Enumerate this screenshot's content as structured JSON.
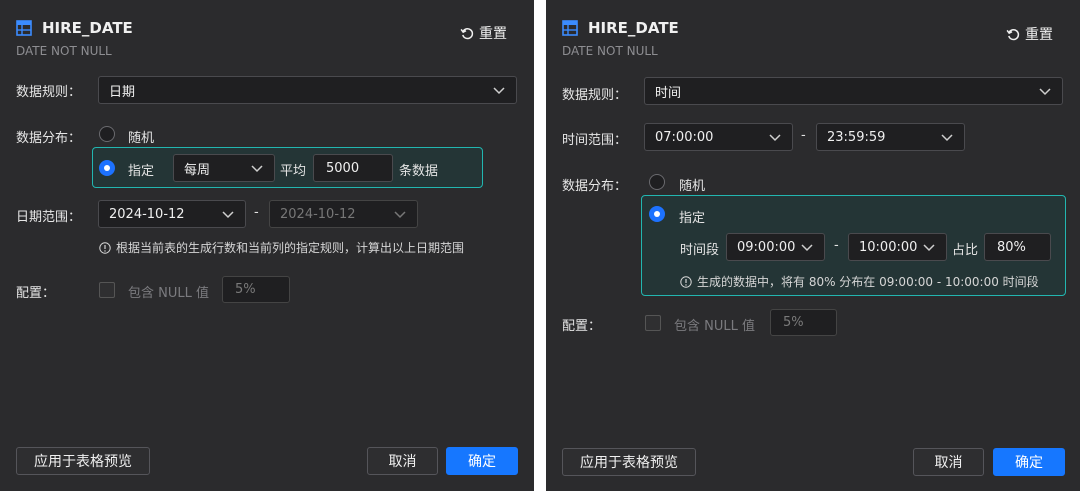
{
  "left": {
    "title": "HIRE_DATE",
    "subtitle": "DATE NOT NULL",
    "reset_label": "重置",
    "rule_label": "数据规则：",
    "rule_value": "日期",
    "dist_label": "数据分布：",
    "random_label": "随机",
    "specified_label": "指定",
    "period_value": "每周",
    "avg_label": "平均",
    "avg_value": "5000",
    "rows_label": "条数据",
    "date_range_label": "日期范围：",
    "date_start": "2024-10-12",
    "date_sep": "-",
    "date_end": "2024-10-12",
    "hint": "根据当前表的生成行数和当前列的指定规则，计算出以上日期范围",
    "config_label": "配置：",
    "null_label": "包含 NULL 值",
    "null_pct": "5%",
    "apply_button": "应用于表格预览",
    "cancel_button": "取消",
    "ok_button": "确定"
  },
  "right": {
    "title": "HIRE_DATE",
    "subtitle": "DATE NOT NULL",
    "reset_label": "重置",
    "rule_label": "数据规则：",
    "rule_value": "时间",
    "time_range_label": "时间范围：",
    "time_start": "07:00:00",
    "time_sep": "-",
    "time_end": "23:59:59",
    "dist_label": "数据分布：",
    "random_label": "随机",
    "specified_label": "指定",
    "segment_label": "时间段",
    "seg_start": "09:00:00",
    "seg_sep": "-",
    "seg_end": "10:00:00",
    "ratio_label": "占比",
    "ratio_value": "80%",
    "hint": "生成的数据中，将有 80% 分布在 09:00:00 - 10:00:00 时间段",
    "config_label": "配置：",
    "null_label": "包含 NULL 值",
    "null_pct": "5%",
    "apply_button": "应用于表格预览",
    "cancel_button": "取消",
    "ok_button": "确定"
  },
  "colors": {
    "panel_bg": "#2b2b2d",
    "accent": "#1677ff",
    "highlight_border": "#22b6b0"
  }
}
